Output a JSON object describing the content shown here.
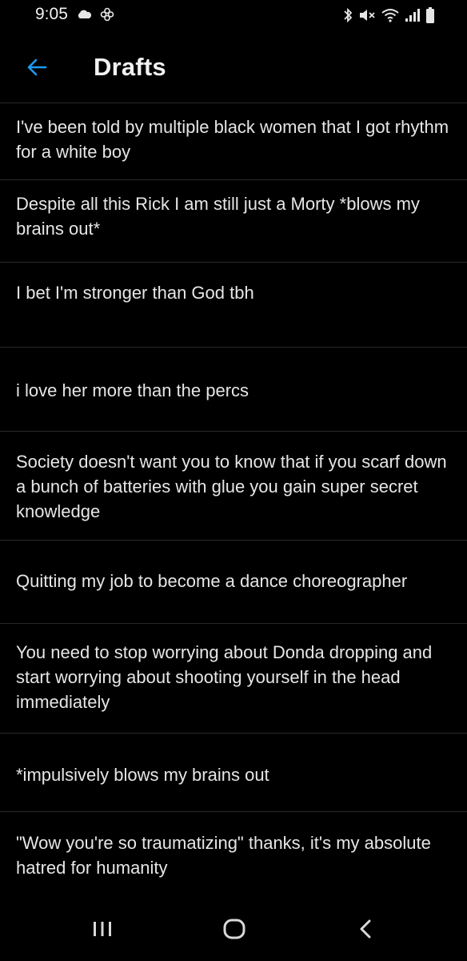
{
  "status_bar": {
    "time": "9:05",
    "icons": [
      "cloud-icon",
      "pinwheel-icon",
      "bluetooth-icon",
      "mute-icon",
      "wifi-icon",
      "signal-icon",
      "battery-icon"
    ]
  },
  "header": {
    "back_icon": "arrow-left-icon",
    "title": "Drafts",
    "accent_color": "#1d9bf0"
  },
  "drafts": [
    "I've been told by multiple black women that I got rhythm for a white boy",
    "Despite all this Rick I am still just a Morty *blows my brains out*",
    "I bet I'm stronger than God tbh",
    "i love her more than the percs",
    "Society doesn't want you to know that if you scarf down a bunch of batteries with glue you gain super secret knowledge",
    "Quitting my job to become a dance choreographer",
    "You need to stop worrying about Donda dropping and start worrying about shooting yourself in the head immediately",
    "*impulsively blows my brains out",
    "\"Wow you're so traumatizing\" thanks, it's my absolute hatred for humanity"
  ],
  "nav_bar": {
    "icons": [
      "recent-apps-icon",
      "home-icon",
      "back-icon"
    ]
  },
  "colors": {
    "background": "#000000",
    "text": "#e6e6e6",
    "divider": "#26292c"
  }
}
